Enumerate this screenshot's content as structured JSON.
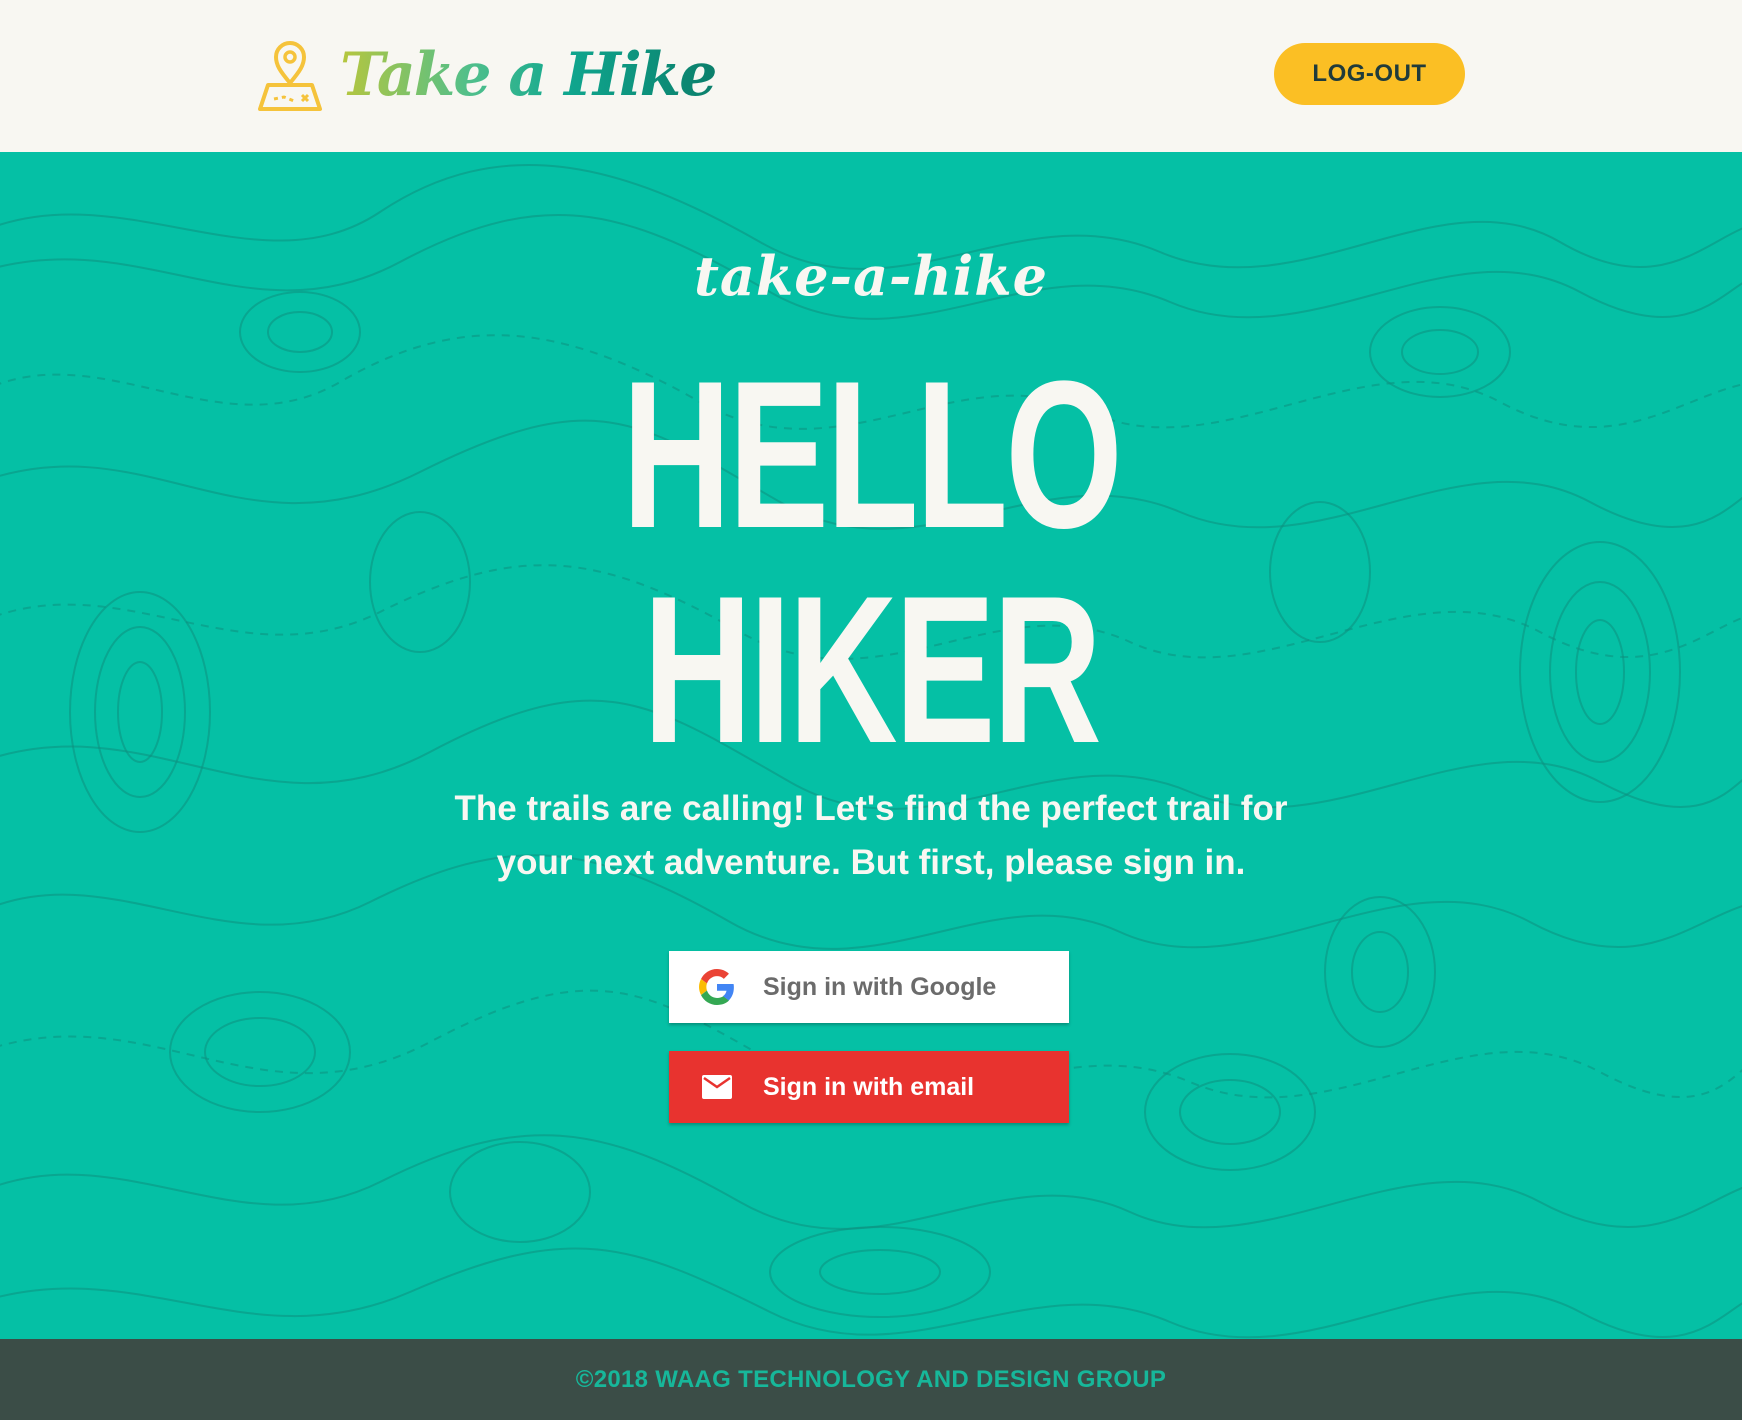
{
  "header": {
    "brand_name": "Take a Hike",
    "brand_icon": "map-pin-icon",
    "logout_label": "LOG-OUT"
  },
  "hero": {
    "tagline": "take-a-hike",
    "headline_line1": "HELLO",
    "headline_line2": "HIKER",
    "intro_line1": "The trails are calling! Let's find the perfect trail for",
    "intro_line2": "your next adventure. But first, please sign in.",
    "google_button_label": "Sign in with Google",
    "google_icon": "google-icon",
    "email_button_label": "Sign in with email",
    "email_icon": "envelope-icon"
  },
  "footer": {
    "copyright": "©2018 WAAG TECHNOLOGY AND DESIGN GROUP"
  },
  "colors": {
    "hero_background": "#05c0a5",
    "header_background": "#f8f7f2",
    "logout_button": "#fbbf24",
    "email_button": "#e8332f",
    "footer_background": "#3b4d47",
    "footer_text": "#17b79a"
  }
}
